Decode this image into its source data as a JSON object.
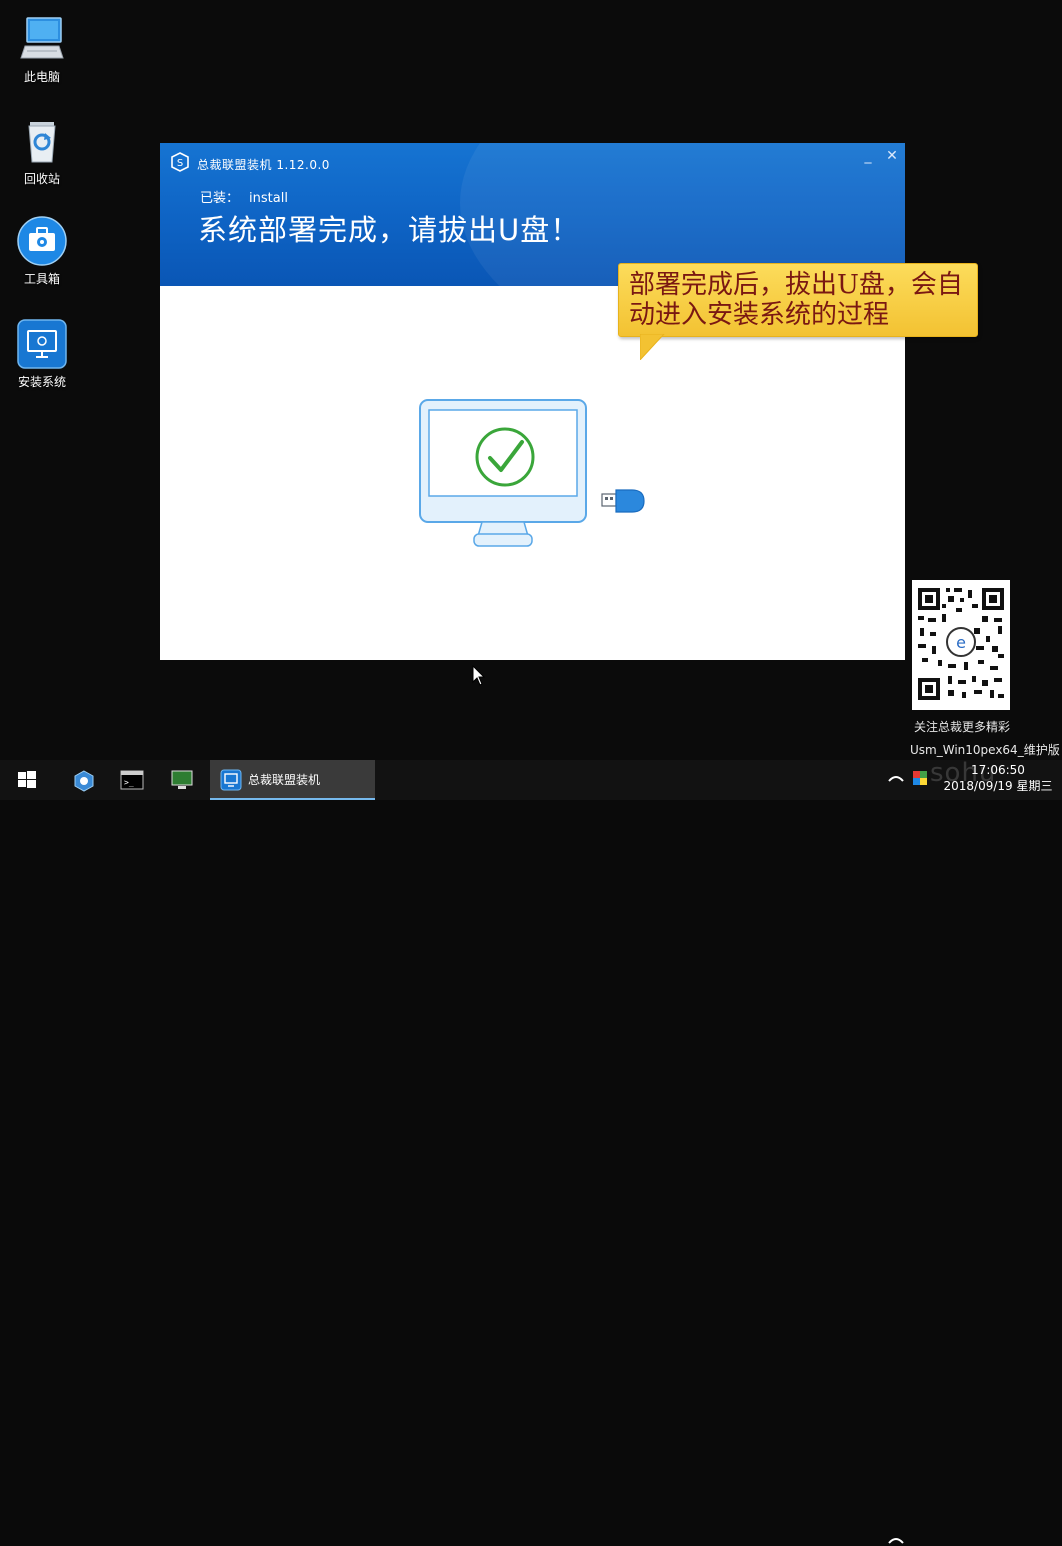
{
  "desktop": {
    "icons": [
      {
        "label": "此电脑",
        "icon": "computer-icon"
      },
      {
        "label": "回收站",
        "icon": "recycle-bin-icon"
      },
      {
        "label": "工具箱",
        "icon": "toolbox-icon"
      },
      {
        "label": "安装系统",
        "icon": "install-system-icon"
      }
    ]
  },
  "window": {
    "title": "总裁联盟装机 1.12.0.0",
    "minimize": "_",
    "close": "✕",
    "status_label": "已装：",
    "status_value": "install",
    "headline": "系统部署完成，请拔出U盘！",
    "colors": {
      "header_blue": "#0e63c4",
      "check_green": "#3aa63a"
    }
  },
  "callout": {
    "text": "部署完成后，拔出U盘，会自动进入安装系统的过程",
    "color": "#f3c232"
  },
  "qr": {
    "caption": "关注总裁更多精彩"
  },
  "os_label": "Usm_Win10pex64_维护版",
  "taskbar": {
    "active_app": "总裁联盟装机",
    "time": "17:06:50",
    "date": "2018/09/19 星期三",
    "buttons": [
      "start-icon",
      "tool-icon",
      "terminal-icon",
      "monitor-icon"
    ]
  },
  "watermark": "sohu"
}
